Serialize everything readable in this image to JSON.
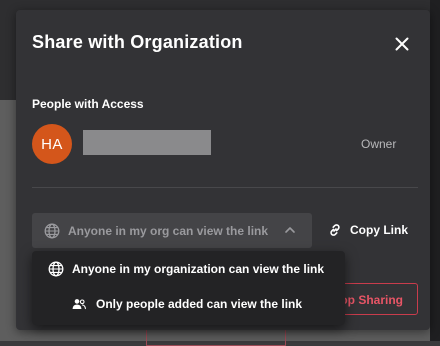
{
  "dialog": {
    "title": "Share with Organization",
    "close_icon": "close-icon"
  },
  "access": {
    "section_label": "People with Access",
    "people": [
      {
        "initials": "HA",
        "role": "Owner",
        "avatar_color": "#d4561b"
      }
    ]
  },
  "link": {
    "select_value": "Anyone in my org can view the link",
    "select_icon": "globe-icon",
    "copy_label": "Copy Link",
    "copy_icon": "link-icon",
    "options": [
      {
        "label": "Anyone in my organization can view the link",
        "icon": "globe-icon"
      },
      {
        "label": "Only people added can view the link",
        "icon": "users-icon"
      }
    ]
  },
  "actions": {
    "stop_sharing_label": "Stop Sharing",
    "danger_color": "#e85566"
  }
}
